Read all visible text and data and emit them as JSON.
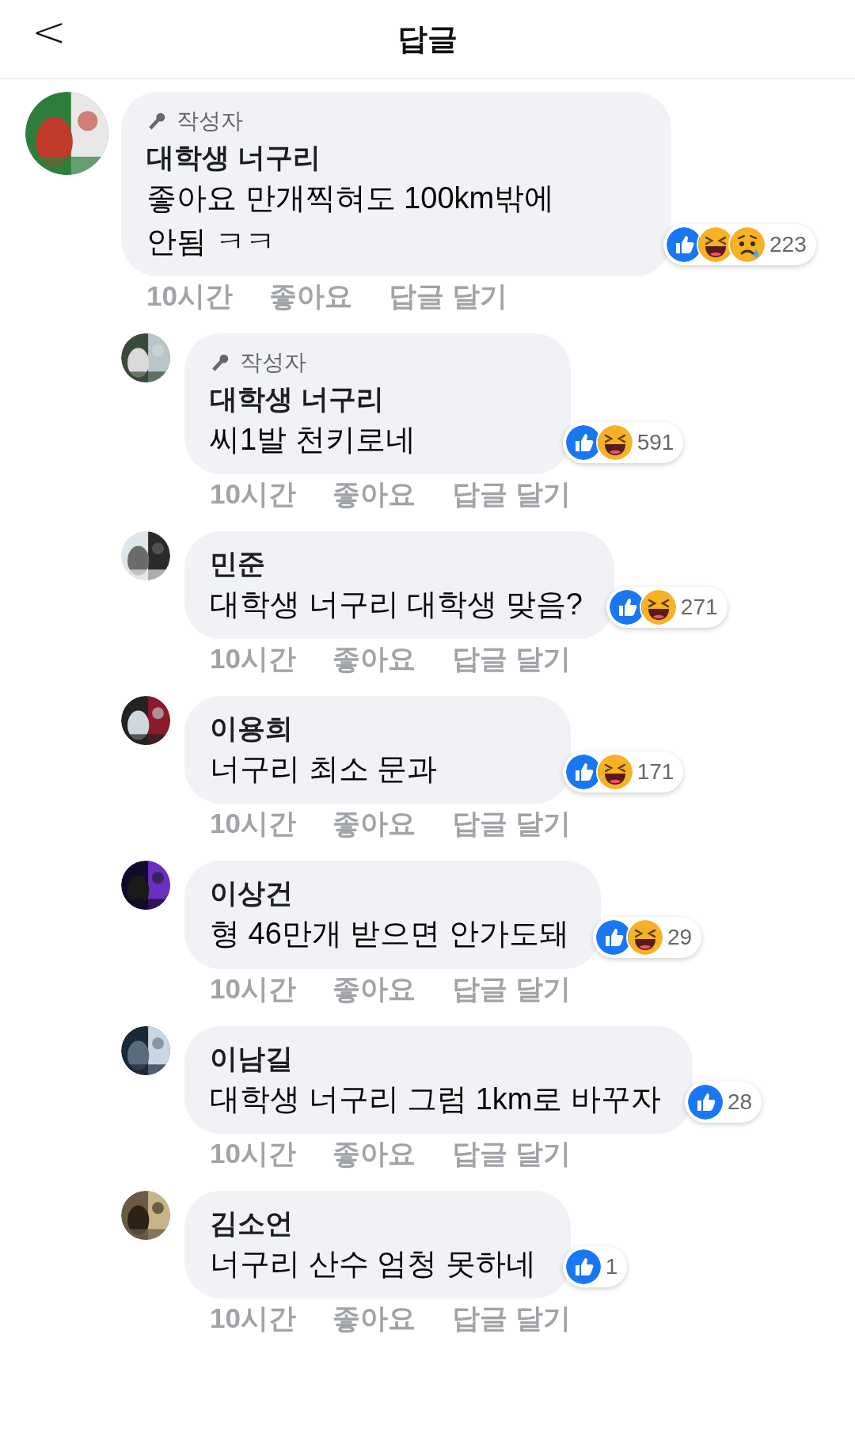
{
  "header": {
    "back": "<",
    "title": "답글"
  },
  "comments": [
    {
      "author_badge": "작성자",
      "name": "대학생 너구리",
      "text": "좋아요 만개찍혀도 100km밖에\n안됨 ㅋㅋ",
      "reactions": [
        {
          "kind": "like"
        },
        {
          "kind": "haha"
        },
        {
          "kind": "sad"
        }
      ],
      "reaction_count": "223",
      "time": "10시간",
      "like": "좋아요",
      "reply": "답글 달기",
      "replies": [
        {
          "author_badge": "작성자",
          "name": "대학생 너구리",
          "text": "씨1발 천키로네",
          "reactions": [
            {
              "kind": "like"
            },
            {
              "kind": "haha"
            }
          ],
          "reaction_count": "591",
          "time": "10시간",
          "like": "좋아요",
          "reply": "답글 달기"
        },
        {
          "name": "민준",
          "text": "대학생 너구리 대학생 맞음?",
          "reactions": [
            {
              "kind": "like"
            },
            {
              "kind": "haha"
            }
          ],
          "reaction_count": "271",
          "time": "10시간",
          "like": "좋아요",
          "reply": "답글 달기"
        },
        {
          "name": "이용희",
          "text": "너구리 최소 문과",
          "reactions": [
            {
              "kind": "like"
            },
            {
              "kind": "haha"
            }
          ],
          "reaction_count": "171",
          "time": "10시간",
          "like": "좋아요",
          "reply": "답글 달기"
        },
        {
          "name": "이상건",
          "text": "형 46만개 받으면 안가도돼",
          "reactions": [
            {
              "kind": "like"
            },
            {
              "kind": "haha"
            }
          ],
          "reaction_count": "29",
          "time": "10시간",
          "like": "좋아요",
          "reply": "답글 달기"
        },
        {
          "name": "이남길",
          "text": "대학생 너구리 그럼 1km로 바꾸자",
          "reactions": [
            {
              "kind": "like"
            }
          ],
          "reaction_count": "28",
          "time": "10시간",
          "like": "좋아요",
          "reply": "답글 달기"
        },
        {
          "name": "김소언",
          "text": "너구리 산수 엄청 못하네",
          "reactions": [
            {
              "kind": "like"
            }
          ],
          "reaction_count": "1",
          "time": "10시간",
          "like": "좋아요",
          "reply": "답글 달기"
        }
      ]
    }
  ]
}
